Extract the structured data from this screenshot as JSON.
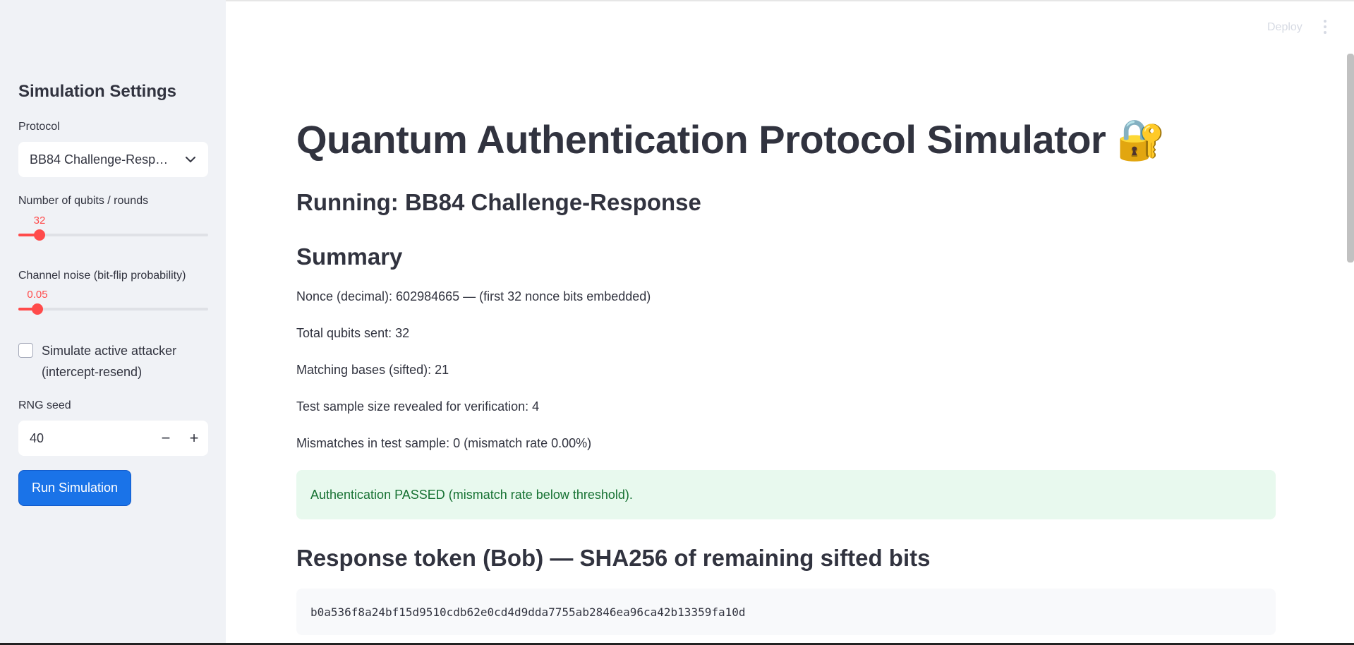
{
  "sidebar": {
    "heading": "Simulation Settings",
    "protocol": {
      "label": "Protocol",
      "value": "BB84 Challenge-Resp…"
    },
    "qubits": {
      "label": "Number of qubits / rounds",
      "value": "32",
      "fraction": 0.11
    },
    "noise": {
      "label": "Channel noise (bit-flip probability)",
      "value": "0.05",
      "fraction": 0.1
    },
    "attacker": {
      "label": "Simulate active attacker (intercept-resend)",
      "checked": false
    },
    "seed": {
      "label": "RNG seed",
      "value": "40",
      "minus": "−",
      "plus": "+"
    },
    "run_button": "Run Simulation"
  },
  "header": {
    "deploy": "Deploy"
  },
  "main": {
    "title": "Quantum Authentication Protocol Simulator 🔐",
    "running": "Running: BB84 Challenge-Response",
    "summary_heading": "Summary",
    "lines": [
      "Nonce (decimal): 602984665 — (first 32 nonce bits embedded)",
      "Total qubits sent: 32",
      "Matching bases (sifted): 21",
      "Test sample size revealed for verification: 4",
      "Mismatches in test sample: 0 (mismatch rate 0.00%)"
    ],
    "success_message": "Authentication PASSED (mismatch rate below threshold).",
    "response_heading": "Response token (Bob) — SHA256 of remaining sifted bits",
    "token": "b0a536f8a24bf15d9510cdb62e0cd4d9dda7755ab2846ea96ca42b13359fa10d"
  },
  "colors": {
    "accent": "#ff4b4b",
    "primary_button": "#1a73e8",
    "success_bg": "#e8f9ee",
    "success_text": "#177233",
    "sidebar_bg": "#f0f2f6"
  }
}
